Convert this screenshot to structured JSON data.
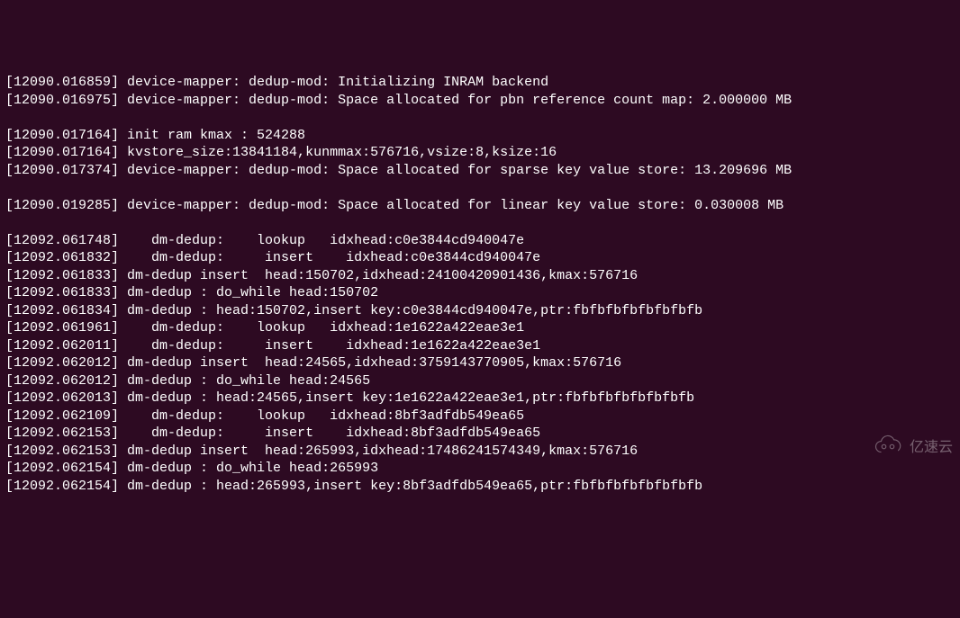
{
  "log": {
    "lines": [
      {
        "ts": "12090.016859",
        "msg": "device-mapper: dedup-mod: Initializing INRAM backend"
      },
      {
        "ts": "12090.016975",
        "msg": "device-mapper: dedup-mod: Space allocated for pbn reference count map: 2.000000 MB"
      },
      {
        "ts": "",
        "msg": ""
      },
      {
        "ts": "12090.017164",
        "msg": "init ram kmax : 524288"
      },
      {
        "ts": "12090.017164",
        "msg": "kvstore_size:13841184,kunmmax:576716,vsize:8,ksize:16"
      },
      {
        "ts": "12090.017374",
        "msg": "device-mapper: dedup-mod: Space allocated for sparse key value store: 13.209696 MB"
      },
      {
        "ts": "",
        "msg": ""
      },
      {
        "ts": "12090.019285",
        "msg": "device-mapper: dedup-mod: Space allocated for linear key value store: 0.030008 MB"
      },
      {
        "ts": "",
        "msg": ""
      },
      {
        "ts": "12092.061748",
        "msg": "   dm-dedup:    lookup   idxhead:c0e3844cd940047e"
      },
      {
        "ts": "12092.061832",
        "msg": "   dm-dedup:     insert    idxhead:c0e3844cd940047e"
      },
      {
        "ts": "12092.061833",
        "msg": "dm-dedup insert  head:150702,idxhead:24100420901436,kmax:576716"
      },
      {
        "ts": "12092.061833",
        "msg": "dm-dedup : do_while head:150702"
      },
      {
        "ts": "12092.061834",
        "msg": "dm-dedup : head:150702,insert key:c0e3844cd940047e,ptr:fbfbfbfbfbfbfbfb"
      },
      {
        "ts": "12092.061961",
        "msg": "   dm-dedup:    lookup   idxhead:1e1622a422eae3e1"
      },
      {
        "ts": "12092.062011",
        "msg": "   dm-dedup:     insert    idxhead:1e1622a422eae3e1"
      },
      {
        "ts": "12092.062012",
        "msg": "dm-dedup insert  head:24565,idxhead:3759143770905,kmax:576716"
      },
      {
        "ts": "12092.062012",
        "msg": "dm-dedup : do_while head:24565"
      },
      {
        "ts": "12092.062013",
        "msg": "dm-dedup : head:24565,insert key:1e1622a422eae3e1,ptr:fbfbfbfbfbfbfbfb"
      },
      {
        "ts": "12092.062109",
        "msg": "   dm-dedup:    lookup   idxhead:8bf3adfdb549ea65"
      },
      {
        "ts": "12092.062153",
        "msg": "   dm-dedup:     insert    idxhead:8bf3adfdb549ea65"
      },
      {
        "ts": "12092.062153",
        "msg": "dm-dedup insert  head:265993,idxhead:17486241574349,kmax:576716"
      },
      {
        "ts": "12092.062154",
        "msg": "dm-dedup : do_while head:265993"
      },
      {
        "ts": "12092.062154",
        "msg": "dm-dedup : head:265993,insert key:8bf3adfdb549ea65,ptr:fbfbfbfbfbfbfbfb"
      }
    ]
  },
  "watermark": {
    "text": "亿速云"
  }
}
